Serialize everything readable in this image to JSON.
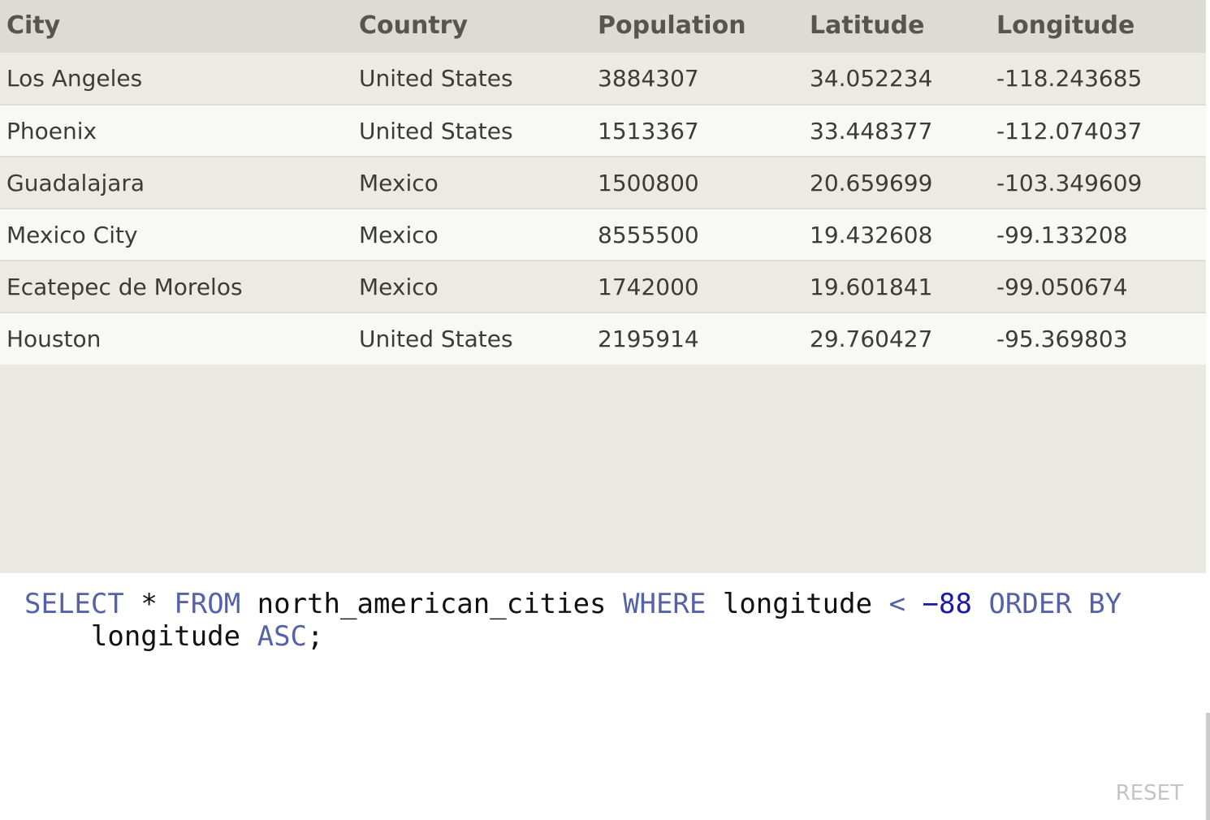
{
  "results": {
    "columns": [
      "City",
      "Country",
      "Population",
      "Latitude",
      "Longitude"
    ],
    "rows": [
      [
        "Los Angeles",
        "United States",
        "3884307",
        "34.052234",
        "-118.243685"
      ],
      [
        "Phoenix",
        "United States",
        "1513367",
        "33.448377",
        "-112.074037"
      ],
      [
        "Guadalajara",
        "Mexico",
        "1500800",
        "20.659699",
        "-103.349609"
      ],
      [
        "Mexico City",
        "Mexico",
        "8555500",
        "19.432608",
        "-99.133208"
      ],
      [
        "Ecatepec de Morelos",
        "Mexico",
        "1742000",
        "19.601841",
        "-99.050674"
      ],
      [
        "Houston",
        "United States",
        "2195914",
        "29.760427",
        "-95.369803"
      ]
    ]
  },
  "editor": {
    "tokens": {
      "select": "SELECT",
      "star": "*",
      "from": "FROM",
      "table": "north_american_cities",
      "where": "WHERE",
      "col1": "longitude",
      "lt": "<",
      "num": "−88",
      "orderby": "ORDER BY",
      "col2": "longitude",
      "asc": "ASC",
      "semi": ";"
    },
    "reset_label": "RESET"
  },
  "colors": {
    "header_bg": "#dcdbd4",
    "row_odd": "#ebeae3",
    "row_even": "#f8f8f6",
    "keyword": "#5563a6",
    "number": "#1a1aa6"
  }
}
